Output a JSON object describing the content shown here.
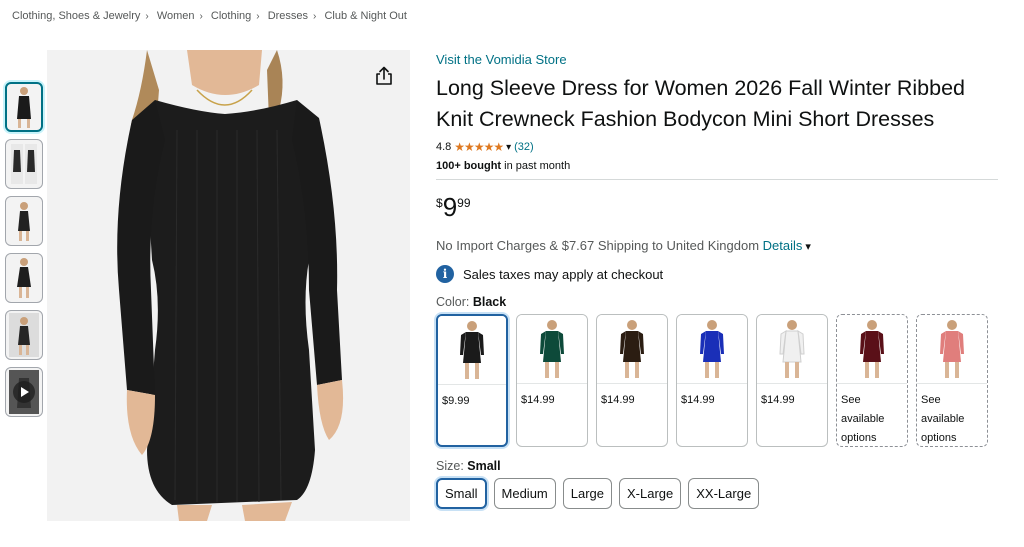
{
  "breadcrumb": [
    "Clothing, Shoes & Jewelry",
    "Women",
    "Clothing",
    "Dresses",
    "Club & Night Out"
  ],
  "store_link": "Visit the Vomidia Store",
  "title": "Long Sleeve Dress for Women 2026 Fall Winter Ribbed Knit Crewneck Fashion Bodycon Mini Short Dresses",
  "rating": {
    "value": "4.8",
    "stars": "★★★★★",
    "count": "(32)"
  },
  "bought": {
    "bold": "100+ bought",
    "rest": " in past month"
  },
  "price": {
    "symbol": "$",
    "whole": "9",
    "fraction": "99"
  },
  "shipping": {
    "text": "No Import Charges & $7.67 Shipping to United Kingdom ",
    "details": "Details"
  },
  "tax_notice": "Sales taxes may apply at checkout",
  "color": {
    "label": "Color: ",
    "selected": "Black"
  },
  "swatches": [
    {
      "color": "#1a1a1a",
      "price": "$9.99"
    },
    {
      "color": "#0d4a3a",
      "price": "$14.99"
    },
    {
      "color": "#2b1d12",
      "price": "$14.99"
    },
    {
      "color": "#1a2fb8",
      "price": "$14.99"
    },
    {
      "color": "#f0f0f0",
      "price": "$14.99"
    },
    {
      "color": "#5a1018",
      "price": "See available options"
    },
    {
      "color": "#e07e7c",
      "price": "See available options"
    }
  ],
  "size": {
    "label": "Size: ",
    "selected": "Small"
  },
  "sizes": [
    "Small",
    "Medium",
    "Large",
    "X-Large",
    "XX-Large"
  ],
  "thumb_colors": [
    "#1a1a1a",
    "#2a2a2a",
    "#222222",
    "#1e1e1e",
    "#262626",
    "#333333"
  ],
  "icons": {
    "share": "share-icon",
    "info": "info-icon",
    "play": "play-icon"
  },
  "accent_color": "#007185"
}
